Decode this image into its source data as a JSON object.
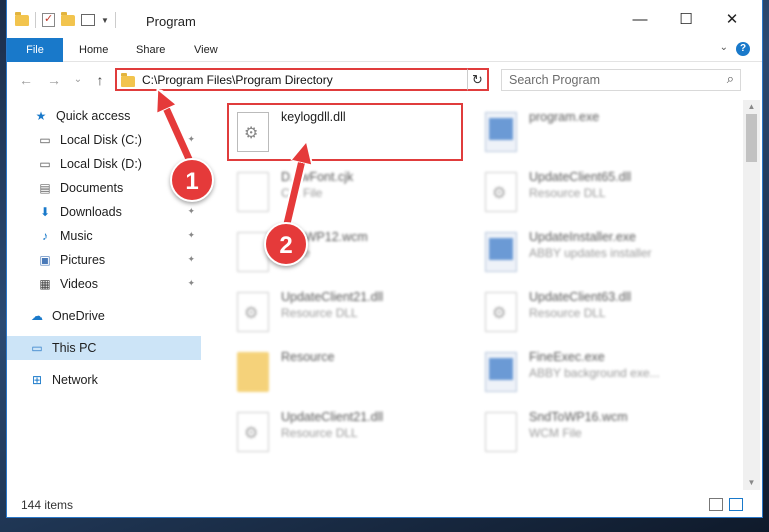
{
  "window": {
    "title": "Program",
    "controls": {
      "minimize": "—",
      "maximize": "☐",
      "close": "✕"
    }
  },
  "ribbon": {
    "tabs": [
      "File",
      "Home",
      "Share",
      "View"
    ],
    "help": "?",
    "collapse": "⌄"
  },
  "navigation": {
    "back": "←",
    "forward": "→",
    "recent": "⌄",
    "up": "↑",
    "address": "C:\\Program Files\\Program Directory",
    "refresh": "↻",
    "search_placeholder": "Search Program",
    "search_icon": "⌕"
  },
  "sidebar": {
    "items": [
      {
        "label": "Quick access",
        "icon": "★",
        "icon_name": "star-icon",
        "color": "#1979ca",
        "pinned": false
      },
      {
        "label": "Local Disk (C:)",
        "icon": "▭",
        "icon_name": "drive-icon",
        "color": "#555",
        "pinned": true
      },
      {
        "label": "Local Disk (D:)",
        "icon": "▭",
        "icon_name": "drive-icon",
        "color": "#555",
        "pinned": true
      },
      {
        "label": "Documents",
        "icon": "▤",
        "icon_name": "documents-icon",
        "color": "#666",
        "pinned": true
      },
      {
        "label": "Downloads",
        "icon": "⬇",
        "icon_name": "download-icon",
        "color": "#1979ca",
        "pinned": true
      },
      {
        "label": "Music",
        "icon": "♪",
        "icon_name": "music-icon",
        "color": "#1979ca",
        "pinned": true
      },
      {
        "label": "Pictures",
        "icon": "▣",
        "icon_name": "pictures-icon",
        "color": "#4a7ab8",
        "pinned": true
      },
      {
        "label": "Videos",
        "icon": "▦",
        "icon_name": "videos-icon",
        "color": "#444",
        "pinned": true
      },
      {
        "label": "OneDrive",
        "icon": "☁",
        "icon_name": "cloud-icon",
        "color": "#1979ca",
        "pinned": false
      },
      {
        "label": "This PC",
        "icon": "▭",
        "icon_name": "computer-icon",
        "color": "#2f7dc8",
        "pinned": false,
        "selected": true
      },
      {
        "label": "Network",
        "icon": "⊞",
        "icon_name": "network-icon",
        "color": "#1979ca",
        "pinned": false
      }
    ],
    "pin_glyph": "📌"
  },
  "files": [
    {
      "name": "keylogdll.dll",
      "type": "",
      "kind": "dll",
      "blurred": false
    },
    {
      "name": "program.exe",
      "type": "",
      "kind": "exe",
      "blurred": true
    },
    {
      "name": "D...wFont.cjk",
      "type": "C... File",
      "kind": "doc",
      "blurred": true
    },
    {
      "name": "UpdateClient65.dll",
      "type": "Resource DLL",
      "kind": "dll",
      "blurred": true
    },
    {
      "name": "...ToWP12.wcm",
      "type": "...File",
      "kind": "doc",
      "blurred": true
    },
    {
      "name": "UpdateInstaller.exe",
      "type": "ABBY updates installer",
      "kind": "exe",
      "blurred": true
    },
    {
      "name": "UpdateClient21.dll",
      "type": "Resource DLL",
      "kind": "dll",
      "blurred": true
    },
    {
      "name": "UpdateClient63.dll",
      "type": "Resource DLL",
      "kind": "dll",
      "blurred": true
    },
    {
      "name": "Resource",
      "type": "",
      "kind": "folder",
      "blurred": true
    },
    {
      "name": "FineExec.exe",
      "type": "ABBY background exe...",
      "kind": "exe",
      "blurred": true
    },
    {
      "name": "UpdateClient21.dll",
      "type": "Resource DLL",
      "kind": "dll",
      "blurred": true
    },
    {
      "name": "SndToWP16.wcm",
      "type": "WCM File",
      "kind": "doc",
      "blurred": true
    }
  ],
  "status": {
    "item_count": "144 items"
  },
  "callouts": {
    "one": "1",
    "two": "2",
    "color": "#e53a3a"
  }
}
